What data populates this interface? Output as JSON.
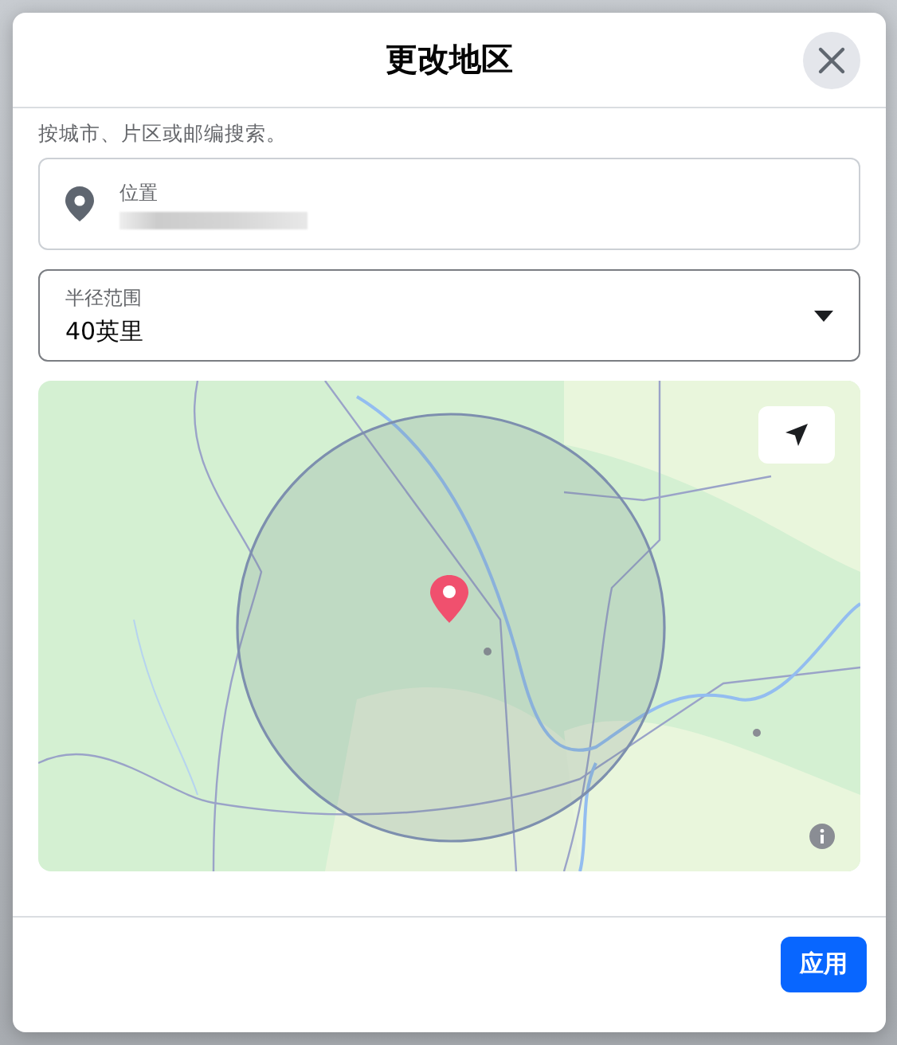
{
  "dialog": {
    "title": "更改地区",
    "hint": "按城市、片区或邮编搜索。",
    "location_field": {
      "label": "位置"
    },
    "radius_select": {
      "label": "半径范围",
      "value": "40英里"
    },
    "apply_button": "应用"
  }
}
